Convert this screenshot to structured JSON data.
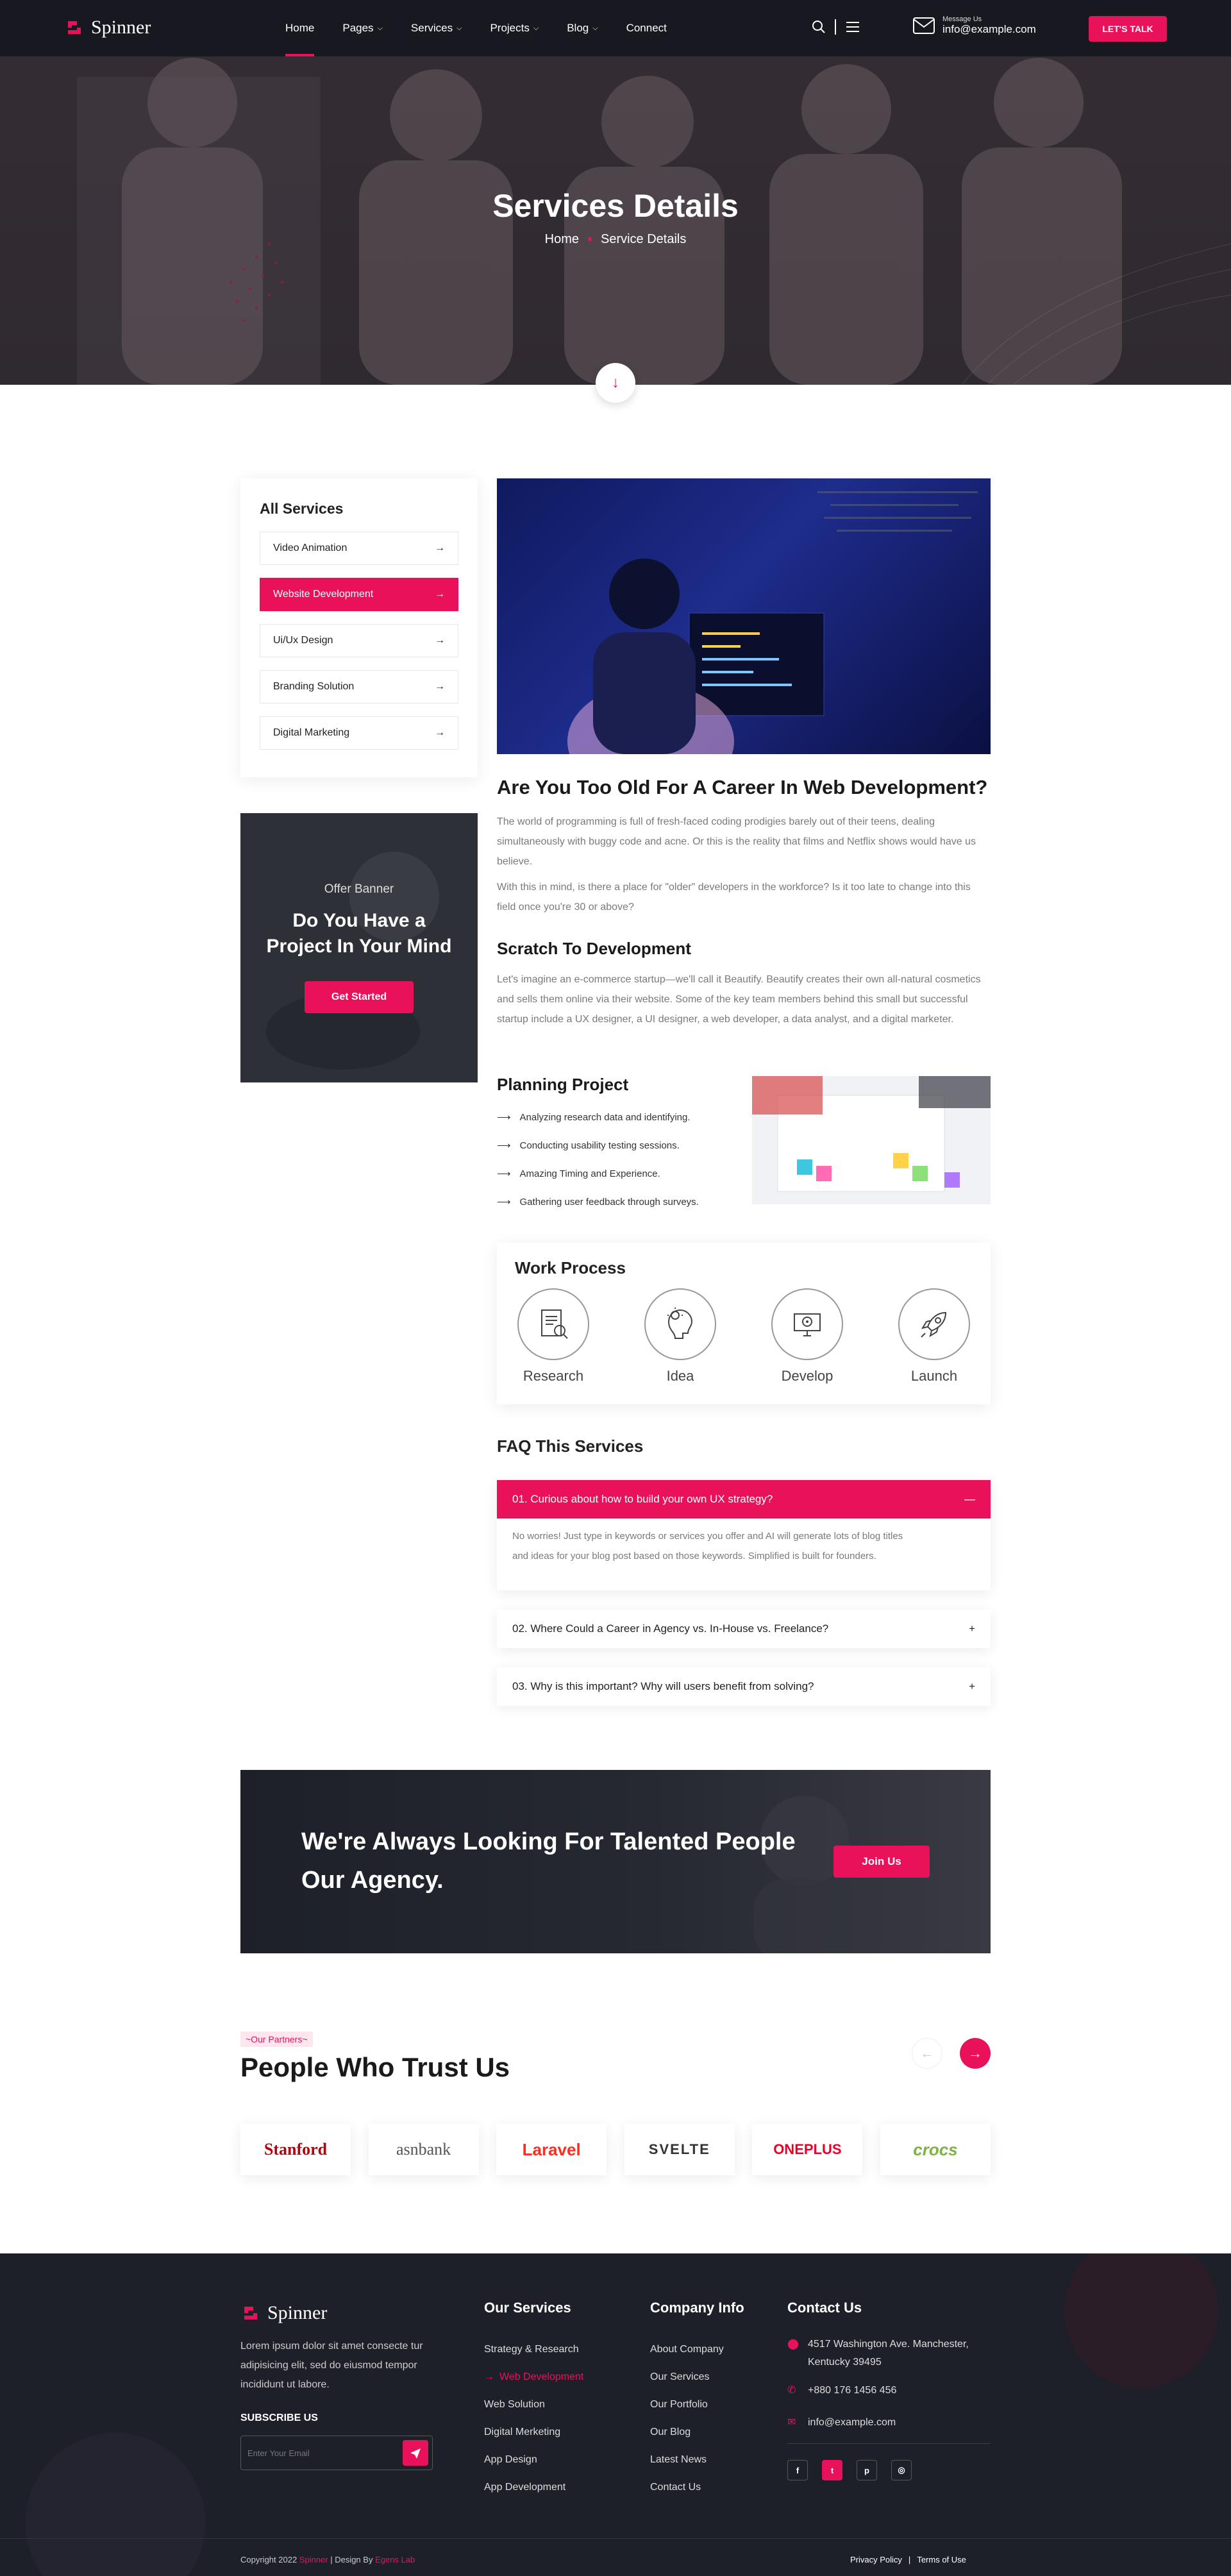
{
  "header": {
    "brand": "Spinner",
    "nav": [
      {
        "label": "Home",
        "caret": ""
      },
      {
        "label": "Pages",
        "caret": "⌵"
      },
      {
        "label": "Services",
        "caret": "⌵"
      },
      {
        "label": "Projects",
        "caret": "⌵"
      },
      {
        "label": "Blog",
        "caret": "⌵"
      },
      {
        "label": "Connect",
        "caret": ""
      }
    ],
    "message_label": "Message Us",
    "email": "info@example.com",
    "cta": "LET'S TALK"
  },
  "hero": {
    "title": "Services Details",
    "crumb_home": "Home",
    "crumb_current": "Service Details"
  },
  "sidebar": {
    "title": "All Services",
    "items": [
      "Video Animation",
      "Website Development",
      "Ui/Ux Design",
      "Branding Solution",
      "Digital Marketing"
    ],
    "active_index": 1,
    "offer": {
      "subtitle": "Offer Banner",
      "title": "Do You Have a Project In Your Mind",
      "button": "Get Started"
    }
  },
  "article": {
    "heading": "Are You Too Old For A Career In Web Development?",
    "para1": "The world of programming is full of fresh-faced coding prodigies barely out of their teens, dealing simultaneously with buggy code and acne. Or this is the reality that films and Netflix shows would have us believe.",
    "para2": "With this in mind, is there a place for \"older\" developers in the workforce? Is it too late to change into this field once you're 30 or above?",
    "scratch_title": "Scratch To Development",
    "scratch_para": "Let's imagine an e-commerce startup—we'll call it Beautify. Beautify creates their own all-natural cosmetics and sells them online via their website. Some of the key team members behind this small but successful startup include a UX designer, a UI designer, a web developer, a data analyst, and a digital marketer.",
    "planning_title": "Planning Project",
    "planning_items": [
      "Analyzing research data and identifying.",
      "Conducting usability testing sessions.",
      "Amazing Timing and Experience.",
      "Gathering user feedback through surveys."
    ]
  },
  "work_process": {
    "title": "Work Process",
    "steps": [
      {
        "label": "Research",
        "icon": "research-icon"
      },
      {
        "label": "Idea",
        "icon": "idea-icon"
      },
      {
        "label": "Develop",
        "icon": "develop-icon"
      },
      {
        "label": "Launch",
        "icon": "rocket-icon"
      }
    ]
  },
  "faq": {
    "title": "FAQ This Services",
    "open": {
      "question": "01. Curious about how to build your own UX strategy?",
      "answer": "No worries! Just type in keywords or services you offer and AI will generate lots of blog titles and ideas for your blog post based on those keywords. Simplified is built for founders."
    },
    "closed": [
      "02. Where Could a Career in Agency vs. In-House vs. Freelance?",
      "03. Why is this important? Why will users benefit from solving?"
    ]
  },
  "talent": {
    "line1": "We're Always Looking For Talented People",
    "line2": "Our Agency.",
    "button": "Join Us"
  },
  "partners": {
    "tag": "~Our Partners~",
    "title": "People Who Trust Us",
    "logos": [
      {
        "name": "Stanford",
        "color": "#b1040e"
      },
      {
        "name": "asnbank",
        "color": "#555555"
      },
      {
        "name": "Laravel",
        "color": "#ff2d20"
      },
      {
        "name": "SVELTE",
        "color": "#333333"
      },
      {
        "name": "ONEPLUS",
        "color": "#eb0028"
      },
      {
        "name": "crocs",
        "color": "#7cb342"
      }
    ]
  },
  "footer": {
    "about": "Lorem ipsum dolor sit amet consecte tur adipisicing elit, sed do eiusmod tempor incididunt ut labore.",
    "subscribe_title": "SUBSCRIBE US",
    "subscribe_placeholder": "Enter Your Email",
    "services_title": "Our Services",
    "services": [
      "Strategy & Research",
      "Web Development",
      "Web Solution",
      "Digital Merketing",
      "App Design",
      "App Development"
    ],
    "company_title": "Company Info",
    "company": [
      "About Company",
      "Our Services",
      "Our Portfolio",
      "Our Blog",
      "Latest News",
      "Contact Us"
    ],
    "contact_title": "Contact Us",
    "address": "4517 Washington Ave. Manchester, Kentucky 39495",
    "phone": "+880 176 1456 456",
    "email": "info@example.com",
    "socials": [
      "f",
      "t",
      "p",
      "◎"
    ],
    "copyright_pre": "Copyright 2022 ",
    "copyright_brand": "Spinner",
    "copyright_mid": " | Design By ",
    "copyright_author": "Egens Lab",
    "privacy": "Privacy Policy",
    "terms": "Terms of Use"
  },
  "colors": {
    "accent": "#e8115a",
    "dark": "#1e2029"
  }
}
